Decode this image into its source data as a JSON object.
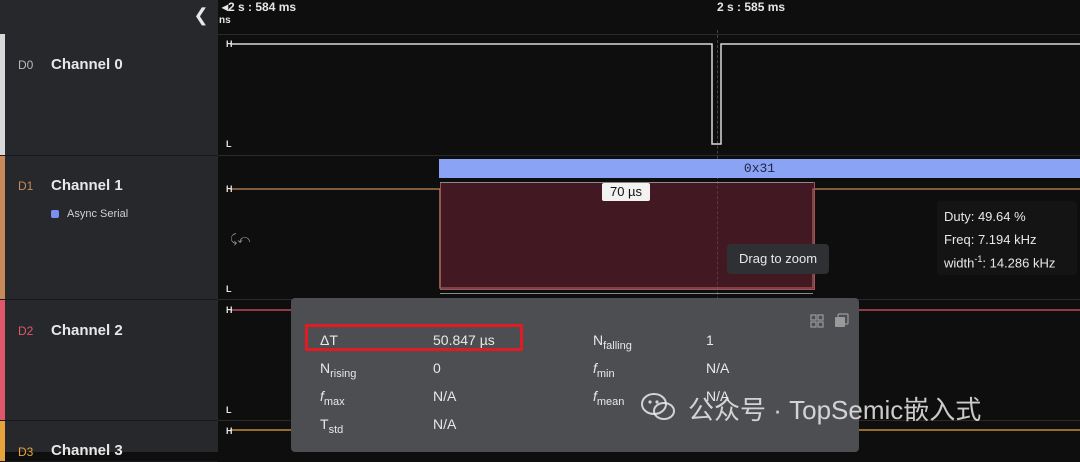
{
  "timeline": {
    "left_label": "2 s : 584 ms",
    "left_unit": "ns",
    "center_label": "2 s : 585 ms"
  },
  "channels": [
    {
      "id": "D0",
      "name": "Channel 0",
      "color": "#d8d8d8"
    },
    {
      "id": "D1",
      "name": "Channel 1",
      "color": "#c8895a",
      "analyzer": "Async Serial"
    },
    {
      "id": "D2",
      "name": "Channel 2",
      "color": "#e0566b"
    },
    {
      "id": "D3",
      "name": "Channel 3",
      "color": "#e8a43a"
    }
  ],
  "levels": {
    "high": "H",
    "low": "L"
  },
  "decode": {
    "value": "0x31",
    "color": "#8aa3f5"
  },
  "measurement": {
    "width_label": "70 µs"
  },
  "drag_tip": "Drag to zoom",
  "duty_box": {
    "duty": "Duty: 49.64 %",
    "freq": "Freq: 7.194 kHz",
    "width_label": "width",
    "width_sup": "-1",
    "width_value": ": 14.286 kHz"
  },
  "stats": {
    "delta_t": {
      "label": "ΔT",
      "value": "50.847 µs"
    },
    "n_rising": {
      "label": "N",
      "sub": "rising",
      "value": "0"
    },
    "f_max": {
      "label": "f",
      "sub": "max",
      "value": "N/A"
    },
    "t_std": {
      "label": "T",
      "sub": "std",
      "value": "N/A"
    },
    "n_falling": {
      "label": "N",
      "sub": "falling",
      "value": "1"
    },
    "f_min": {
      "label": "f",
      "sub": "min",
      "value": "N/A"
    },
    "f_mean": {
      "label": "f",
      "sub": "mean",
      "value": "N/A"
    }
  },
  "watermark": "公众号 · TopSemic嵌入式",
  "icons": {
    "collapse": "chevron-left-icon",
    "grid": "grid-icon",
    "copy": "copy-icon",
    "trigger": "trigger-icon"
  }
}
